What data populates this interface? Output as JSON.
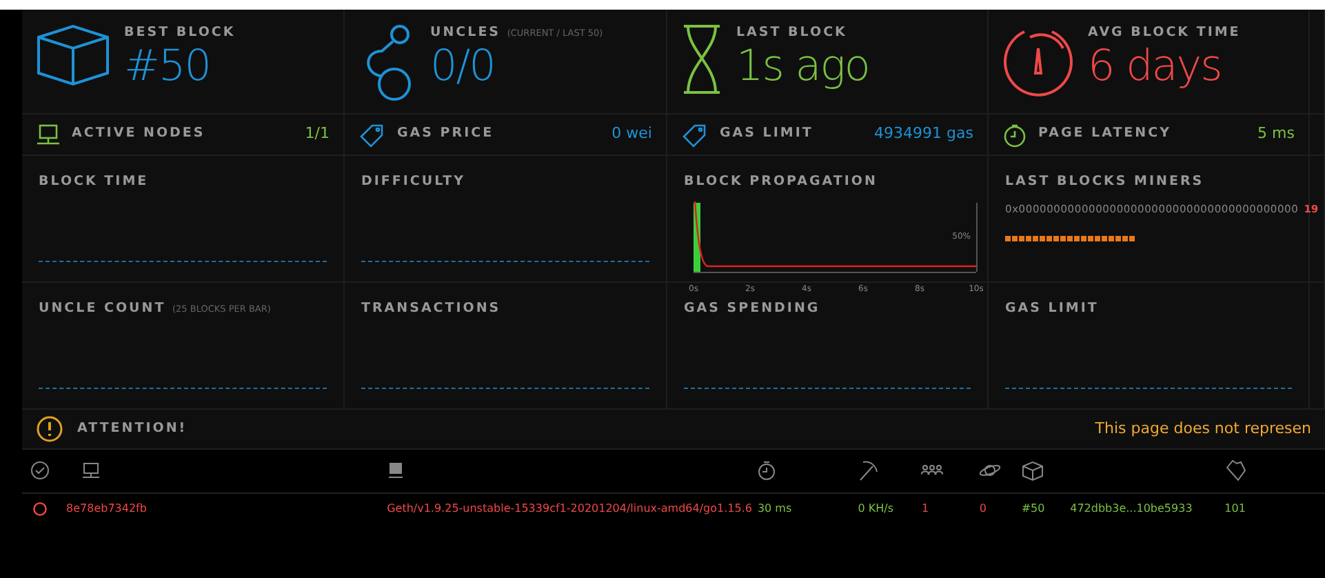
{
  "stats": [
    {
      "label": "BEST BLOCK",
      "value": "#50",
      "color": "#1e92d6"
    },
    {
      "label": "UNCLES",
      "note": "(CURRENT / LAST 50)",
      "value": "0/0",
      "color": "#1e92d6"
    },
    {
      "label": "LAST BLOCK",
      "value": "1s ago",
      "color": "#7bc143"
    },
    {
      "label": "AVG BLOCK TIME",
      "value": "6 days",
      "color": "#f04848"
    }
  ],
  "metrics": [
    {
      "label": "ACTIVE NODES",
      "value": "1/1",
      "color": "#7bc143"
    },
    {
      "label": "GAS PRICE",
      "value": "0 wei",
      "color": "#1e92d6"
    },
    {
      "label": "GAS LIMIT",
      "value": "4934991 gas",
      "color": "#1e92d6"
    },
    {
      "label": "PAGE LATENCY",
      "value": "5 ms",
      "color": "#7bc143"
    }
  ],
  "charts": [
    {
      "kind": "empty",
      "title": "BLOCK TIME"
    },
    {
      "kind": "empty",
      "title": "DIFFICULTY"
    },
    {
      "kind": "propagation",
      "title": "BLOCK PROPAGATION",
      "x_ticks": [
        "0s",
        "2s",
        "4s",
        "6s",
        "8s",
        "10s"
      ],
      "y_tick": "50%"
    },
    {
      "kind": "miners",
      "title": "LAST BLOCKS MINERS",
      "address": "0x0000000000000000000000000000000000000000",
      "count": "19"
    },
    {
      "kind": "empty",
      "title": "UNCLE COUNT",
      "note": "(25 BLOCKS PER BAR)"
    },
    {
      "kind": "empty",
      "title": "TRANSACTIONS"
    },
    {
      "kind": "empty",
      "title": "GAS SPENDING"
    },
    {
      "kind": "empty",
      "title": "GAS LIMIT"
    }
  ],
  "attention": {
    "title": "ATTENTION!",
    "message": "This page does not represen"
  },
  "nodes": [
    {
      "color": "#f04848",
      "cells": [
        {
          "text": "8e78eb7342fb",
          "color": "#f04848"
        },
        {
          "text": "Geth/v1.9.25-unstable-15339cf1-20201204/linux-amd64/go1.15.6",
          "color": "#f04848"
        },
        {
          "text": "30 ms",
          "color": "#7bc143"
        },
        {
          "text": "0 KH/s",
          "color": "#7bc143"
        },
        {
          "text": "1",
          "color": "#f04848"
        },
        {
          "text": "0",
          "color": "#f04848"
        },
        {
          "text": "#50",
          "color": "#7bc143"
        },
        {
          "text": "472dbb3e...10be5933",
          "color": "#7bc143"
        },
        {
          "text": "101",
          "color": "#7bc143"
        }
      ]
    }
  ]
}
